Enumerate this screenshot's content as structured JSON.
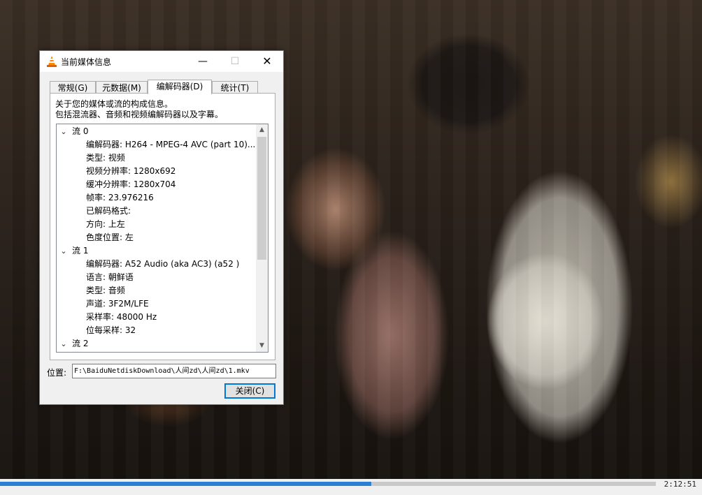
{
  "window": {
    "title": "当前媒体信息",
    "minimize": "—",
    "maximize": "☐",
    "close": "✕"
  },
  "tabs": [
    {
      "label": "常规(G)"
    },
    {
      "label": "元数据(M)"
    },
    {
      "label": "编解码器(D)"
    },
    {
      "label": "统计(T)"
    }
  ],
  "active_tab": "编解码器(D)",
  "description": {
    "line1": "关于您的媒体或流的构成信息。",
    "line2": "包括混流器、音频和视频编解码器以及字幕。"
  },
  "tree": {
    "stream0": {
      "label": "流 0",
      "items": [
        "编解码器: H264 - MPEG-4 AVC (part 10)...",
        "类型: 视频",
        "视频分辨率: 1280x692",
        "缓冲分辨率: 1280x704",
        "帧率: 23.976216",
        "已解码格式:",
        "方向: 上左",
        "色度位置: 左"
      ]
    },
    "stream1": {
      "label": "流 1",
      "items": [
        "编解码器: A52 Audio (aka AC3) (a52 )",
        "语言: 朝鲜语",
        "类型: 音频",
        "声道: 3F2M/LFE",
        "采样率: 48000 Hz",
        "位每采样: 32"
      ]
    },
    "stream2": {
      "label": "流 2"
    },
    "expanded_glyph": "⌄",
    "scroll_up": "▲",
    "scroll_down": "▼"
  },
  "location": {
    "label": "位置:",
    "value": "F:\\BaiduNetdiskDownload\\人间zd\\人间zd\\1.mkv"
  },
  "close_button": "关闭(C)",
  "player": {
    "elapsed": "2:12:51",
    "progress_fraction": 0.566
  },
  "colors": {
    "accent": "#0078d7",
    "progress": "#2c7fd3"
  }
}
